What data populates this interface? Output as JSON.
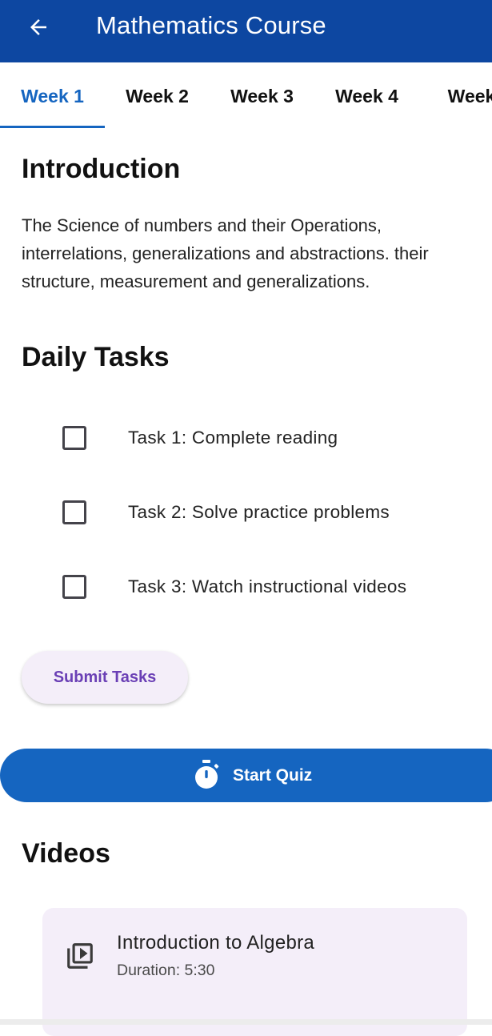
{
  "app_bar": {
    "title": "Mathematics Course",
    "back_icon": "arrow-back-icon",
    "background": "#0d47a1"
  },
  "tabs": {
    "items": [
      {
        "label": "Week 1",
        "selected": true
      },
      {
        "label": "Week 2",
        "selected": false
      },
      {
        "label": "Week 3",
        "selected": false
      },
      {
        "label": "Week 4",
        "selected": false
      },
      {
        "label": "Week",
        "selected": false
      }
    ],
    "accent": "#1565c0"
  },
  "introduction": {
    "heading": "Introduction",
    "body": "The Science of numbers and their Operations, interrelations, generalizations and abstractions. their structure, measurement and generalizations."
  },
  "daily_tasks": {
    "heading": "Daily Tasks",
    "items": [
      {
        "label": "Task 1: Complete reading",
        "checked": false
      },
      {
        "label": "Task 2: Solve practice problems",
        "checked": false
      },
      {
        "label": "Task 3: Watch instructional videos",
        "checked": false
      }
    ],
    "submit_label": "Submit Tasks"
  },
  "quiz": {
    "label": "Start Quiz",
    "icon": "timer-icon",
    "color": "#1565c0"
  },
  "videos": {
    "heading": "Videos",
    "items": [
      {
        "title": "Introduction to Algebra",
        "duration": "Duration: 5:30",
        "icon": "video-library-icon"
      }
    ]
  }
}
